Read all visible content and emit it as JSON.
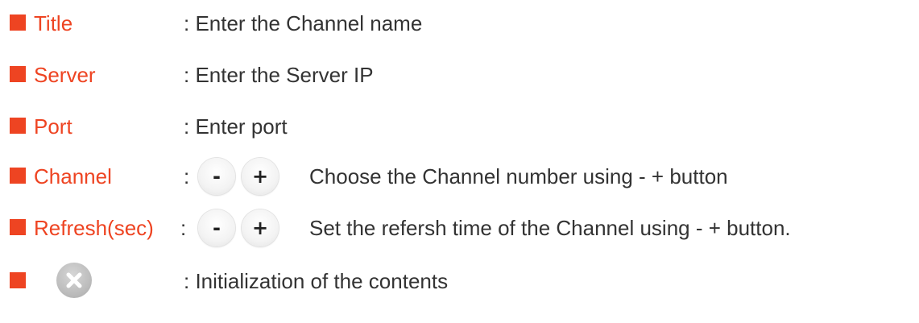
{
  "items": [
    {
      "label": "Title",
      "description": ": Enter the Channel name"
    },
    {
      "label": "Server",
      "description": ": Enter the Server IP"
    },
    {
      "label": "Port",
      "description": ": Enter port"
    },
    {
      "label": "Channel",
      "colon": ":",
      "minus": "-",
      "plus": "+",
      "description": "Choose the Channel number using - + button"
    },
    {
      "label": "Refresh(sec)",
      "colon": ":",
      "minus": "-",
      "plus": "+",
      "description": "Set the refersh time of the Channel using - + button."
    },
    {
      "icon": "close-icon",
      "description": ": Initialization of the contents"
    }
  ],
  "colors": {
    "accent": "#ee4422",
    "text": "#333333",
    "icon_gray": "#b8b8b8"
  }
}
